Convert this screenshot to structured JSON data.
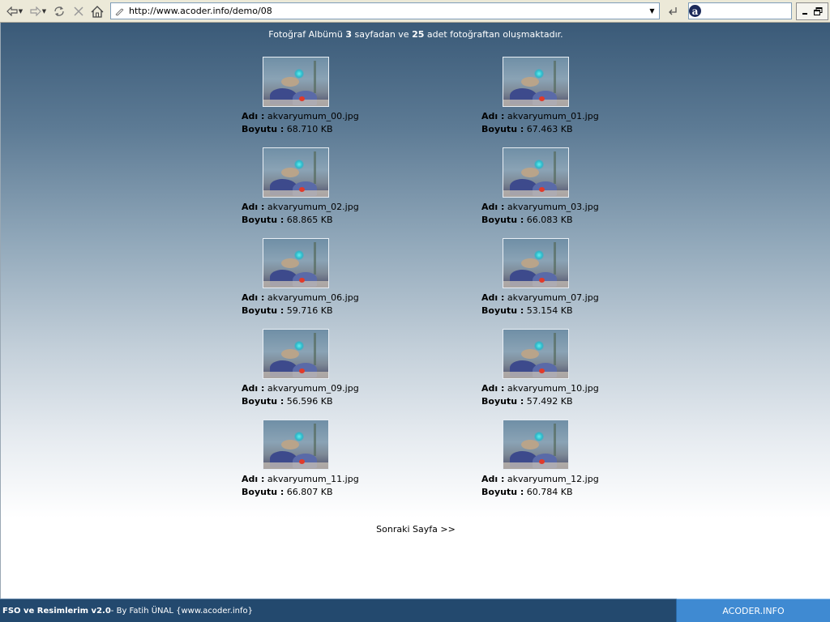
{
  "browser": {
    "url": "http://www.acoder.info/demo/08",
    "search_value": ""
  },
  "summary": {
    "prefix": "Fotoğraf Albümü ",
    "pages": "3",
    "middle": " sayfadan ve ",
    "count": "25",
    "suffix": " adet fotoğraftan oluşmaktadır."
  },
  "labels": {
    "name": "Adı :",
    "size": "Boyutu :"
  },
  "photos": [
    {
      "name": "akvaryumum_00.jpg",
      "size": "68.710 KB"
    },
    {
      "name": "akvaryumum_01.jpg",
      "size": "67.463 KB"
    },
    {
      "name": "akvaryumum_02.jpg",
      "size": "68.865 KB"
    },
    {
      "name": "akvaryumum_03.jpg",
      "size": "66.083 KB"
    },
    {
      "name": "akvaryumum_06.jpg",
      "size": "59.716 KB"
    },
    {
      "name": "akvaryumum_07.jpg",
      "size": "53.154 KB"
    },
    {
      "name": "akvaryumum_09.jpg",
      "size": "56.596 KB"
    },
    {
      "name": "akvaryumum_10.jpg",
      "size": "57.492 KB"
    },
    {
      "name": "akvaryumum_11.jpg",
      "size": "66.807 KB"
    },
    {
      "name": "akvaryumum_12.jpg",
      "size": "60.784 KB"
    }
  ],
  "next_page": "Sonraki Sayfa >>",
  "footer": {
    "app_name": "FSO ve Resimlerim v2.0",
    "credit": " - By Fatih ÜNAL {www.acoder.info}",
    "brand": "ACODER.INFO"
  },
  "colors": {
    "footer_left": "#23496e",
    "footer_right": "#3f8ad2",
    "gradient_top": "#3a5a78"
  },
  "icons": [
    "back-icon",
    "forward-icon",
    "refresh-icon",
    "stop-icon",
    "home-icon",
    "page-icon",
    "go-icon",
    "search-engine-icon",
    "minimize-icon",
    "restore-icon"
  ]
}
